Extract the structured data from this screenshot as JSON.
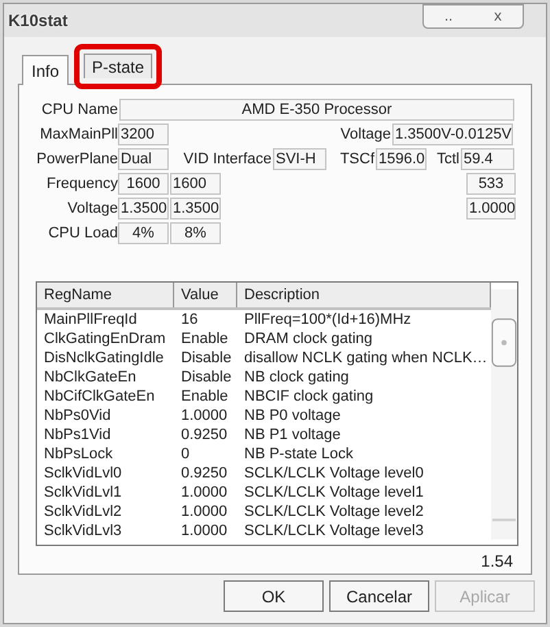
{
  "window": {
    "title": "K10stat",
    "controls": [
      "..",
      "x"
    ]
  },
  "tabs": [
    {
      "label": "Info",
      "selected": true,
      "highlighted": false
    },
    {
      "label": "P-state",
      "selected": false,
      "highlighted": true
    }
  ],
  "info_rows": [
    [
      {
        "kind": "label",
        "text": "CPU Name"
      },
      {
        "kind": "field",
        "text": "AMD E-350 Processor"
      }
    ],
    [
      {
        "kind": "label",
        "text": "MaxMainPll"
      },
      {
        "kind": "field",
        "text": "3200"
      },
      {
        "kind": "label",
        "text": "Voltage"
      },
      {
        "kind": "field",
        "text": "1.3500V-0.0125V"
      }
    ],
    [
      {
        "kind": "label",
        "text": "PowerPlane"
      },
      {
        "kind": "field",
        "text": "Dual"
      },
      {
        "kind": "label",
        "text": "VID Interface"
      },
      {
        "kind": "field",
        "text": "SVI-H"
      },
      {
        "kind": "label",
        "text": "TSCf"
      },
      {
        "kind": "field",
        "text": "1596.0"
      },
      {
        "kind": "label",
        "text": "Tctl"
      },
      {
        "kind": "field",
        "text": "59.4"
      }
    ],
    [
      {
        "kind": "label",
        "text": "Frequency"
      },
      {
        "kind": "field",
        "text": "1600"
      },
      {
        "kind": "field",
        "text": "1600"
      },
      {
        "kind": "field",
        "text": "533"
      }
    ],
    [
      {
        "kind": "label",
        "text": "Voltage"
      },
      {
        "kind": "field",
        "text": "1.3500"
      },
      {
        "kind": "field",
        "text": "1.3500"
      },
      {
        "kind": "field",
        "text": "1.0000"
      }
    ],
    [
      {
        "kind": "label",
        "text": "CPU Load"
      },
      {
        "kind": "field",
        "text": "4%"
      },
      {
        "kind": "field",
        "text": "8%"
      }
    ]
  ],
  "table": {
    "columns": [
      "RegName",
      "Value",
      "Description"
    ],
    "rows": [
      [
        "MainPllFreqId",
        "16",
        "PllFreq=100*(Id+16)MHz"
      ],
      [
        "ClkGatingEnDram",
        "Enable",
        "DRAM clock gating"
      ],
      [
        "DisNclkGatingIdle",
        "Disable",
        "disallow NCLK gating when NCLK…"
      ],
      [
        "NbClkGateEn",
        "Disable",
        "NB clock gating"
      ],
      [
        "NbCifClkGateEn",
        "Enable",
        "NBCIF clock gating"
      ],
      [
        "NbPs0Vid",
        "1.0000",
        "NB P0 voltage"
      ],
      [
        "NbPs1Vid",
        "0.9250",
        "NB P1 voltage"
      ],
      [
        "NbPsLock",
        "0",
        "NB P-state Lock"
      ],
      [
        "SclkVidLvl0",
        "0.9250",
        "SCLK/LCLK Voltage level0"
      ],
      [
        "SclkVidLvl1",
        "1.0000",
        "SCLK/LCLK Voltage level1"
      ],
      [
        "SclkVidLvl2",
        "1.0000",
        "SCLK/LCLK Voltage level2"
      ],
      [
        "SclkVidLvl3",
        "1.0000",
        "SCLK/LCLK Voltage level3"
      ]
    ]
  },
  "version": "1.54",
  "buttons": [
    {
      "label": "OK",
      "disabled": false
    },
    {
      "label": "Cancelar",
      "disabled": false
    },
    {
      "label": "Aplicar",
      "disabled": true
    }
  ]
}
